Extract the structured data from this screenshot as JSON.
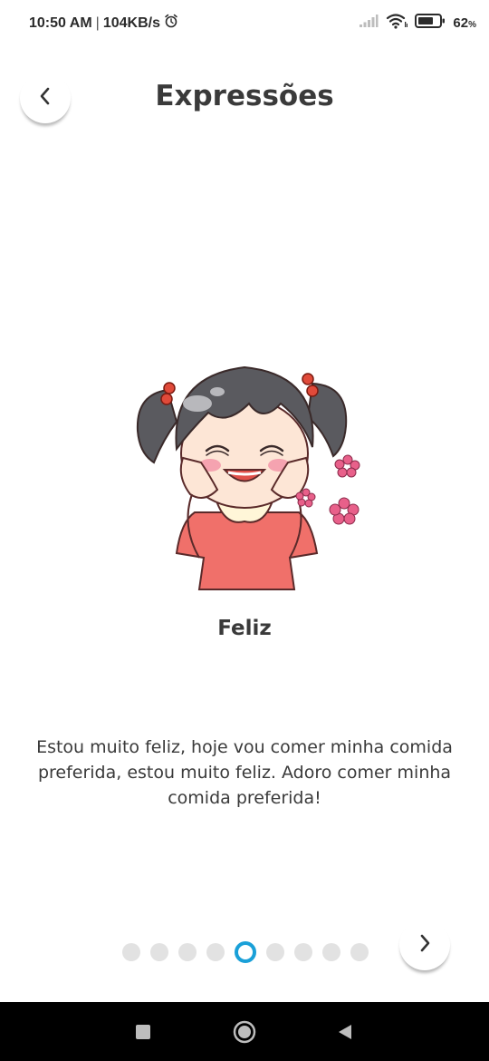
{
  "status_bar": {
    "time": "10:50 AM",
    "separator": "|",
    "network_speed": "104KB/s",
    "battery_level": "62",
    "battery_unit": "%",
    "icons": [
      "alarm-icon",
      "signal-icon",
      "wifi-icon",
      "battery-icon"
    ]
  },
  "header": {
    "title": "Expressões",
    "back_icon": "chevron-left-icon"
  },
  "expression": {
    "name": "Feliz",
    "description": "Estou muito feliz, hoje vou comer minha comida preferida, estou muito feliz. Adoro comer minha comida preferida!",
    "illustration": "happy-girl-illustration"
  },
  "pagination": {
    "total": 9,
    "current": 5,
    "next_icon": "chevron-right-icon"
  },
  "nav_bar": {
    "icons": [
      "recents-square-icon",
      "home-circle-icon",
      "back-triangle-icon"
    ]
  },
  "colors": {
    "accent": "#1aa0d8",
    "text": "#3a3a3a",
    "dot_inactive": "#e2e2e2",
    "nav_bar": "#000000"
  }
}
